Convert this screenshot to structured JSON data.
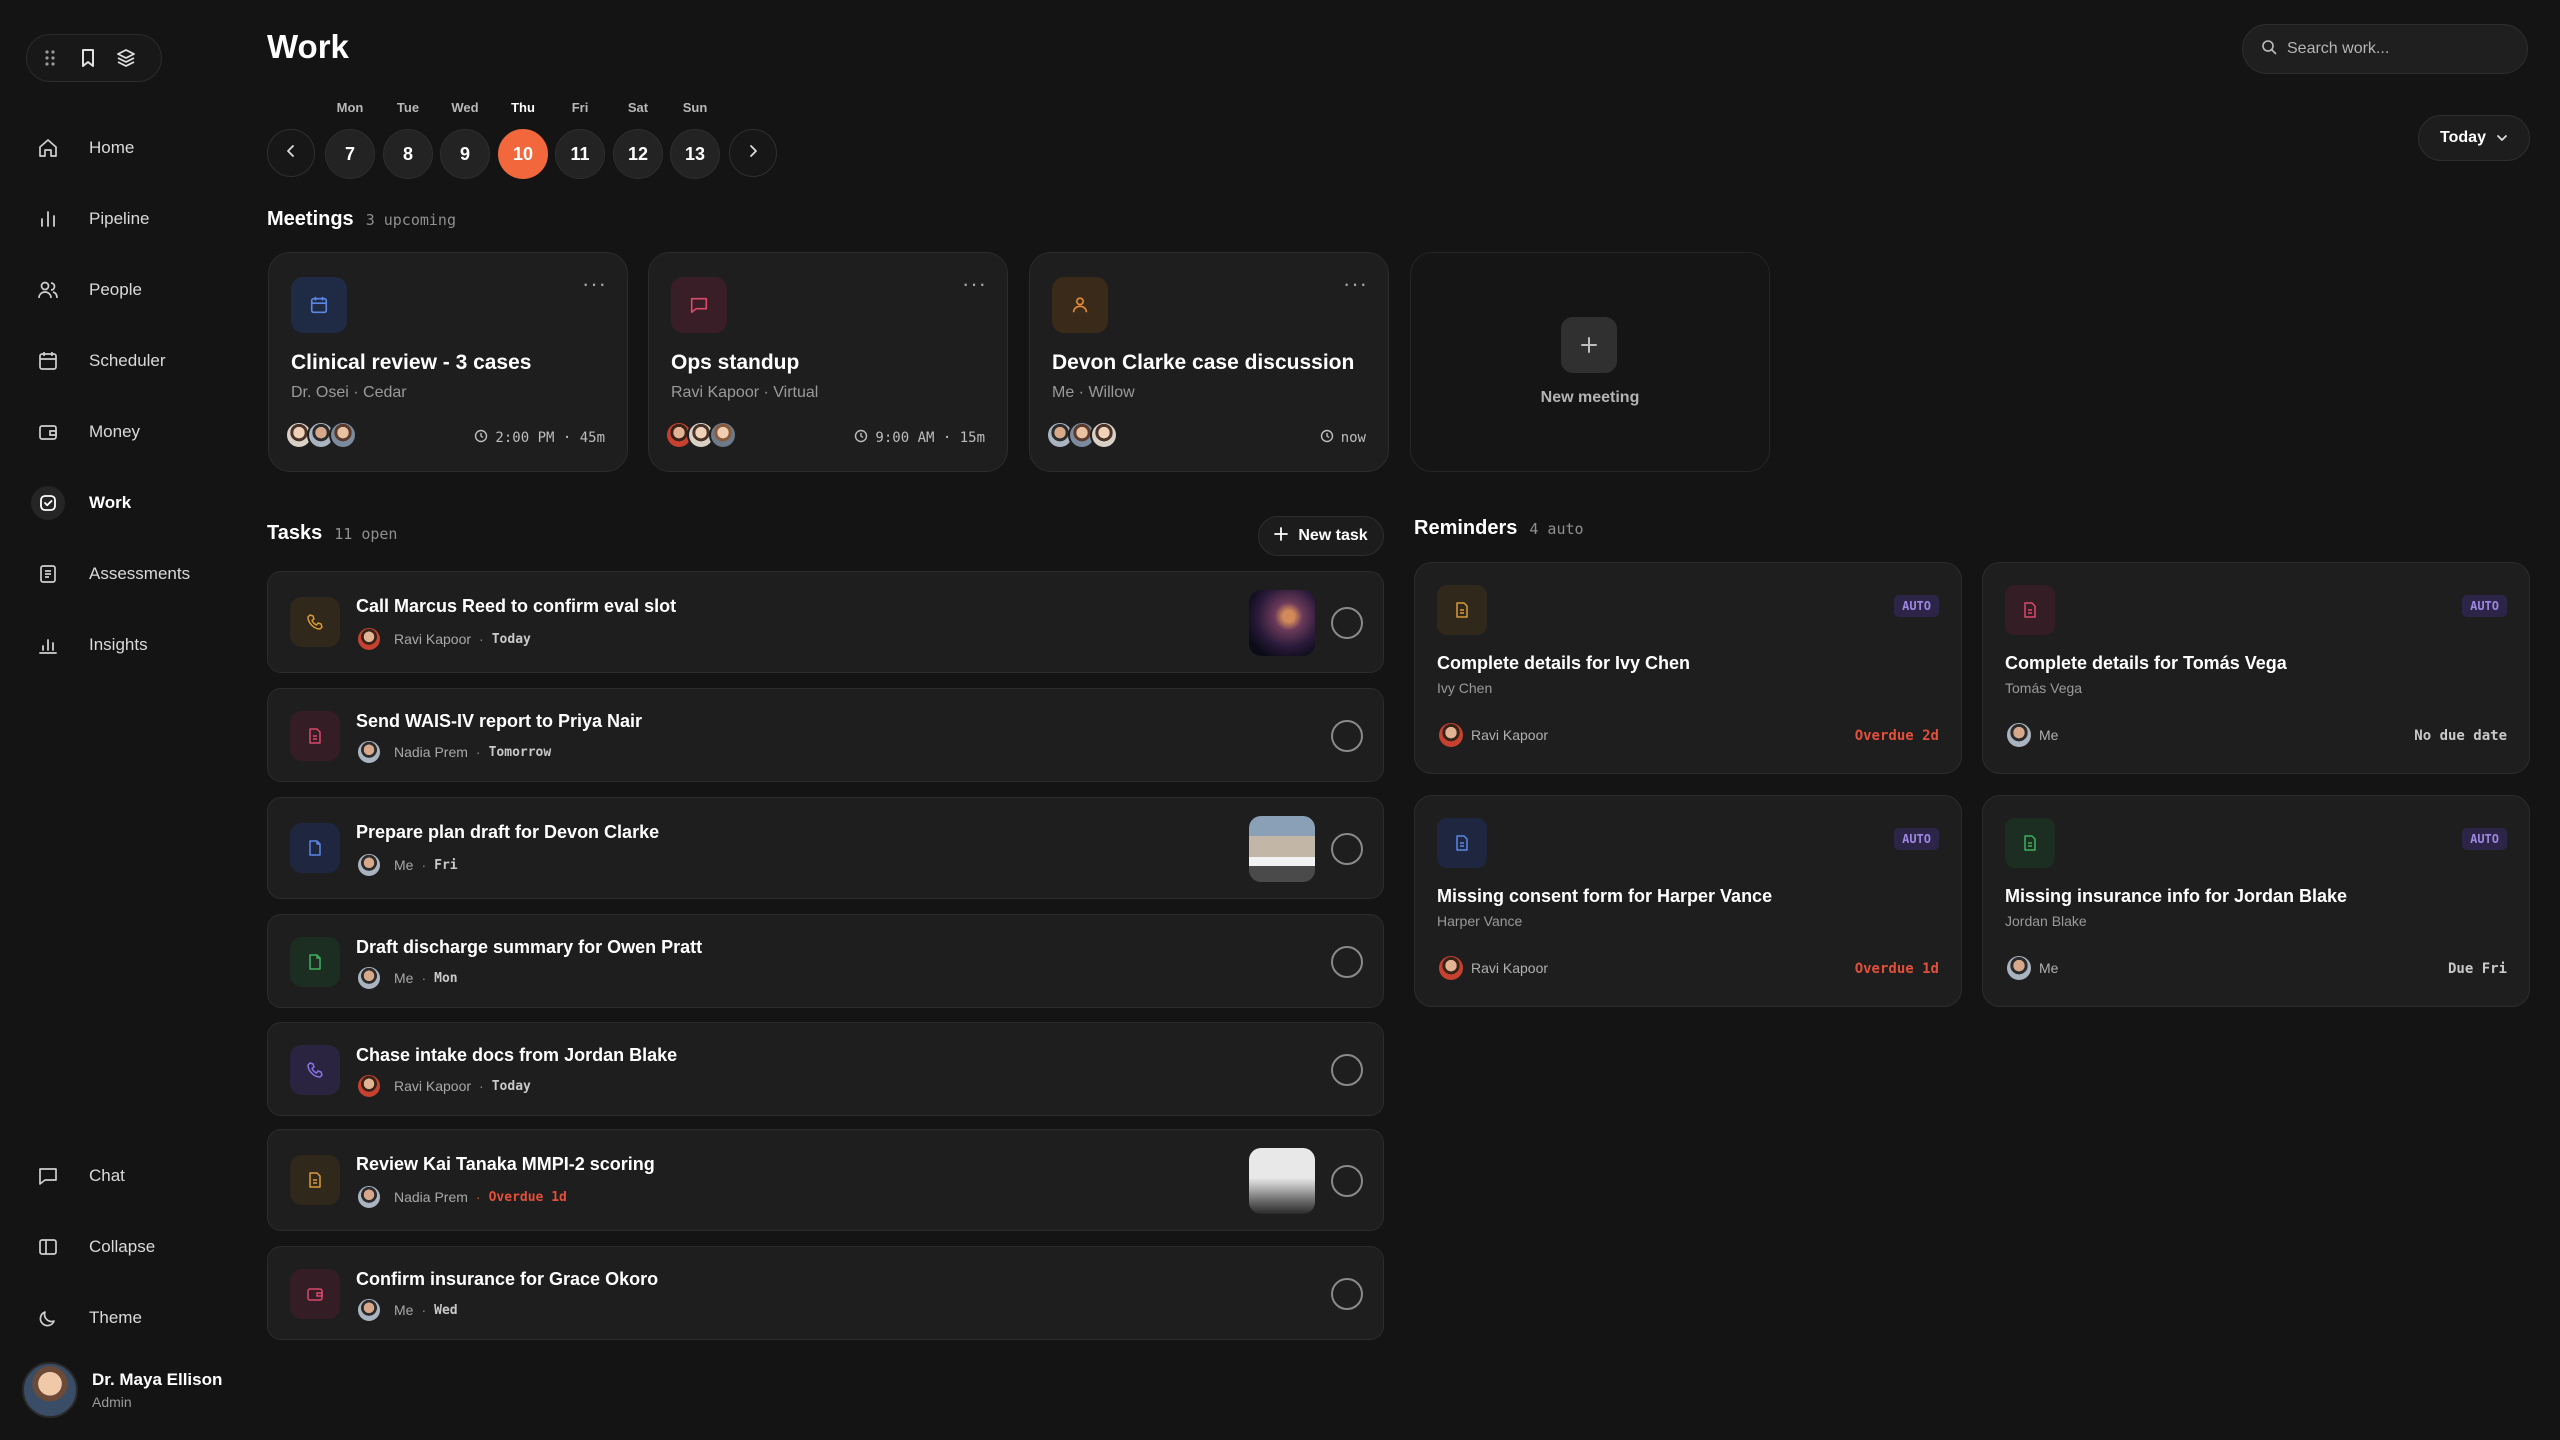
{
  "sidebar": {
    "nav": [
      {
        "label": "Home",
        "icon": "home-icon"
      },
      {
        "label": "Pipeline",
        "icon": "bar-chart-icon"
      },
      {
        "label": "People",
        "icon": "people-icon"
      },
      {
        "label": "Scheduler",
        "icon": "calendar-icon"
      },
      {
        "label": "Money",
        "icon": "wallet-icon"
      },
      {
        "label": "Work",
        "icon": "check-square-icon",
        "active": true
      },
      {
        "label": "Assessments",
        "icon": "document-icon"
      },
      {
        "label": "Insights",
        "icon": "bar-chart-icon"
      }
    ],
    "bottom": [
      {
        "label": "Chat",
        "icon": "chat-icon"
      },
      {
        "label": "Collapse",
        "icon": "sidebar-icon"
      },
      {
        "label": "Theme",
        "icon": "moon-icon"
      }
    ],
    "user": {
      "name": "Dr. Maya Ellison",
      "role": "Admin"
    }
  },
  "header": {
    "title": "Work",
    "search_placeholder": "Search work...",
    "today_label": "Today"
  },
  "week": {
    "days": [
      {
        "label": "Mon",
        "num": "7"
      },
      {
        "label": "Tue",
        "num": "8"
      },
      {
        "label": "Wed",
        "num": "9"
      },
      {
        "label": "Thu",
        "num": "10",
        "active": true
      },
      {
        "label": "Fri",
        "num": "11"
      },
      {
        "label": "Sat",
        "num": "12"
      },
      {
        "label": "Sun",
        "num": "13"
      }
    ]
  },
  "meetings": {
    "title": "Meetings",
    "count": "3 upcoming",
    "items": [
      {
        "title": "Clinical review - 3 cases",
        "sub": "Dr. Osei · Cedar",
        "time": "2:00 PM · 45m",
        "icon": "calendar-icon",
        "accent": "#4f7bd8"
      },
      {
        "title": "Ops standup",
        "sub": "Ravi Kapoor · Virtual",
        "time": "9:00 AM · 15m",
        "icon": "chat-icon",
        "accent": "#d04a6a"
      },
      {
        "title": "Devon Clarke case discussion",
        "sub": "Me · Willow",
        "time": "now",
        "icon": "person-icon",
        "accent": "#d8873a"
      }
    ],
    "new_label": "New meeting"
  },
  "tasks": {
    "title": "Tasks",
    "count": "11 open",
    "new_label": "New task",
    "items": [
      {
        "title": "Call Marcus Reed to confirm eval slot",
        "owner": "Ravi Kapoor",
        "due": "Today",
        "icon": "phone-icon",
        "accent": "#d8933a",
        "thumb": "space"
      },
      {
        "title": "Send WAIS-IV report to Priya Nair",
        "owner": "Nadia Prem",
        "due": "Tomorrow",
        "icon": "document-icon",
        "accent": "#d04a6a"
      },
      {
        "title": "Prepare plan draft for Devon Clarke",
        "owner": "Me",
        "due": "Fri",
        "icon": "document-icon",
        "accent": "#4f7bd8",
        "thumb": "street"
      },
      {
        "title": "Draft discharge summary for Owen Pratt",
        "owner": "Me",
        "due": "Mon",
        "icon": "document-icon",
        "accent": "#3fa65a"
      },
      {
        "title": "Chase intake docs from Jordan Blake",
        "owner": "Ravi Kapoor",
        "due": "Today",
        "icon": "phone-icon",
        "accent": "#7f6be0"
      },
      {
        "title": "Review Kai Tanaka MMPI-2 scoring",
        "owner": "Nadia Prem",
        "due": "Overdue 1d",
        "overdue": true,
        "icon": "document-icon",
        "accent": "#d8933a",
        "thumb": "fog"
      },
      {
        "title": "Confirm insurance for Grace Okoro",
        "owner": "Me",
        "due": "Wed",
        "icon": "wallet-icon",
        "accent": "#d04a6a"
      }
    ]
  },
  "reminders": {
    "title": "Reminders",
    "count": "4 auto",
    "items": [
      {
        "title": "Complete details for Ivy Chen",
        "sub": "Ivy Chen",
        "owner": "Ravi Kapoor",
        "due": "Overdue 2d",
        "overdue": true,
        "badge": "AUTO",
        "icon": "document-icon",
        "accent": "#d8933a"
      },
      {
        "title": "Complete details for Tomás Vega",
        "sub": "Tomás Vega",
        "owner": "Me",
        "due": "No due date",
        "badge": "AUTO",
        "icon": "document-icon",
        "accent": "#d04a6a"
      },
      {
        "title": "Missing consent form for Harper Vance",
        "sub": "Harper Vance",
        "owner": "Ravi Kapoor",
        "due": "Overdue 1d",
        "overdue": true,
        "badge": "AUTO",
        "icon": "document-icon",
        "accent": "#4f7bd8"
      },
      {
        "title": "Missing insurance info for Jordan Blake",
        "sub": "Jordan Blake",
        "owner": "Me",
        "due": "Due Fri",
        "badge": "AUTO",
        "icon": "document-icon",
        "accent": "#3fa65a"
      }
    ]
  }
}
